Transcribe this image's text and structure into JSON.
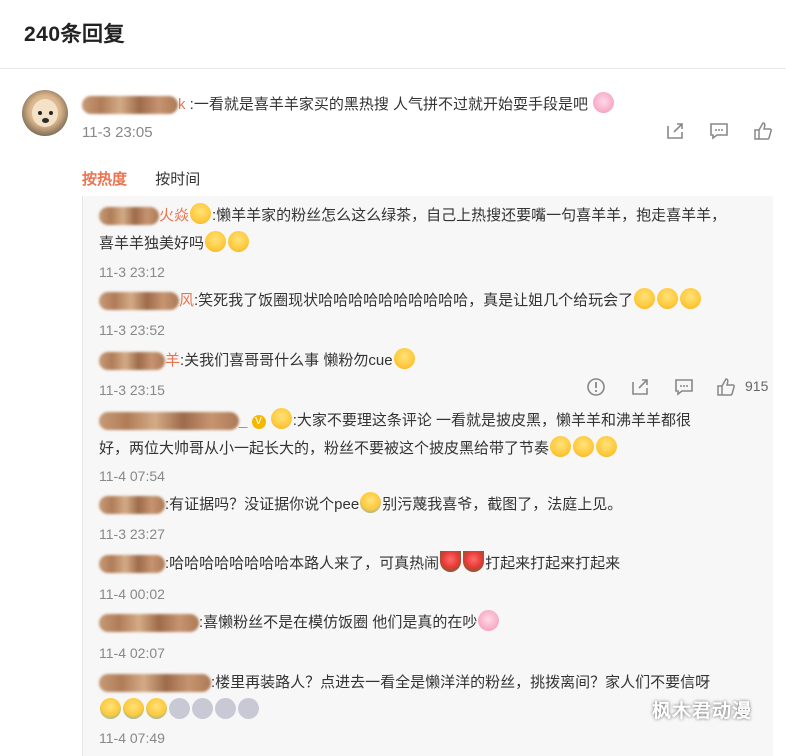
{
  "header": {
    "title": "240条回复"
  },
  "main_comment": {
    "name_tail": "k",
    "text": ":一看就是喜羊羊家买的黑热搜 人气拼不过就开始耍手段是吧",
    "time": "11-3 23:05",
    "emoji": "pig"
  },
  "sort": {
    "hot": "按热度",
    "time": "按时间"
  },
  "replies": [
    {
      "name_tail": "火焱",
      "line1": ":懒羊羊家的粉丝怎么这么绿茶，自己上热搜还要嘴一句喜羊羊，抱走喜羊羊，",
      "line2": "喜羊羊独美好吗",
      "time": "11-3 23:12"
    },
    {
      "name_tail": "风",
      "line1": ":笑死我了饭圈现状哈哈哈哈哈哈哈哈哈哈，真是让姐几个给玩会了",
      "time": "11-3 23:52"
    },
    {
      "name_tail": "羊",
      "line1": ":关我们喜哥哥什么事 懒粉勿cue",
      "time": "11-3 23:15",
      "likes": "915"
    },
    {
      "name_tail": "_",
      "line1": ":大家不要理这条评论 一看就是披皮黑，懒羊羊和沸羊羊都很",
      "line2": "好，两位大帅哥从小一起长大的，粉丝不要被这个披皮黑给带了节奏",
      "time": "11-4 07:54"
    },
    {
      "name_tail": "",
      "line1a": ":有证据吗？没证据你说个pee",
      "line1b": "别污蔑我喜爷，截图了，法庭上见。",
      "time": "11-3 23:27"
    },
    {
      "name_tail": "",
      "line1a": ":哈哈哈哈哈哈哈哈本路人来了，可真热闹",
      "line1b": "打起来打起来打起来",
      "time": "11-4 00:02"
    },
    {
      "name_tail": "",
      "line1": ":喜懒粉丝不是在模仿饭圈 他们是真的在吵",
      "time": "11-4 02:07"
    },
    {
      "name_tail": "",
      "line1": ":楼里再装路人？点进去一看全是懒洋洋的粉丝，挑拨离间？家人们不要信呀",
      "time": "11-4 07:49"
    }
  ],
  "watermark": "枫木君动漫",
  "colors": {
    "accent": "#eb7350",
    "muted": "#888888",
    "panel": "#f7f7f7"
  }
}
